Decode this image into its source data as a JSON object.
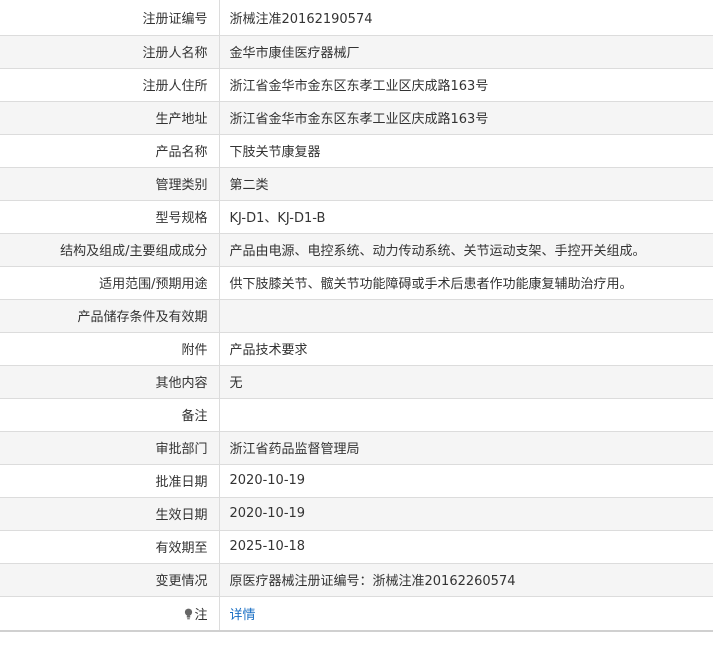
{
  "rows": [
    {
      "label": "注册证编号",
      "value": "浙械注准20162190574"
    },
    {
      "label": "注册人名称",
      "value": "金华市康佳医疗器械厂"
    },
    {
      "label": "注册人住所",
      "value": "浙江省金华市金东区东孝工业区庆成路163号"
    },
    {
      "label": "生产地址",
      "value": "浙江省金华市金东区东孝工业区庆成路163号"
    },
    {
      "label": "产品名称",
      "value": "下肢关节康复器"
    },
    {
      "label": "管理类别",
      "value": "第二类"
    },
    {
      "label": "型号规格",
      "value": "KJ-D1、KJ-D1-B"
    },
    {
      "label": "结构及组成/主要组成成分",
      "value": "产品由电源、电控系统、动力传动系统、关节运动支架、手控开关组成。"
    },
    {
      "label": "适用范围/预期用途",
      "value": "供下肢膝关节、髋关节功能障碍或手术后患者作功能康复辅助治疗用。"
    },
    {
      "label": "产品储存条件及有效期",
      "value": ""
    },
    {
      "label": "附件",
      "value": "产品技术要求"
    },
    {
      "label": "其他内容",
      "value": "无"
    },
    {
      "label": "备注",
      "value": ""
    },
    {
      "label": "审批部门",
      "value": "浙江省药品监督管理局"
    },
    {
      "label": "批准日期",
      "value": "2020-10-19"
    },
    {
      "label": "生效日期",
      "value": "2020-10-19"
    },
    {
      "label": "有效期至",
      "value": "2025-10-18"
    },
    {
      "label": "变更情况",
      "value": "原医疗器械注册证编号：浙械注准20162260574"
    }
  ],
  "note": {
    "icon": "bulb-icon",
    "label": "注",
    "link_text": "详情",
    "link_color": "#1a6fc4"
  }
}
